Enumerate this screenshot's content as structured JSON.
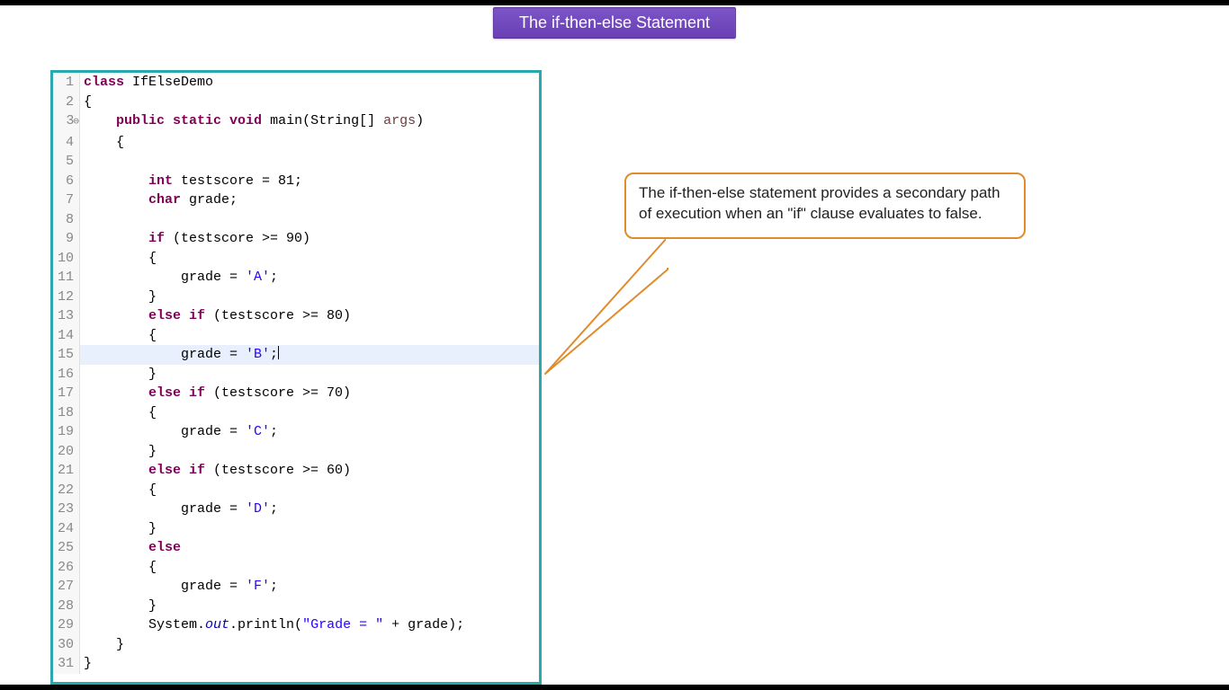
{
  "title": "The if-then-else Statement",
  "callout": "The if-then-else statement provides a secondary path of execution when an \"if\" clause evaluates to false.",
  "code": {
    "highlight_line": 15,
    "lines": [
      {
        "n": "1",
        "html": "<span class='kw'>class</span> <span class='cls'>IfElseDemo</span>",
        "indent": 0
      },
      {
        "n": "2",
        "html": "{",
        "indent": 0
      },
      {
        "n": "3",
        "marker": "⊖",
        "html": "    <span class='kw'>public static void</span> <span class='mth'>main</span>(String[] <span class='par'>args</span>)",
        "indent": 0
      },
      {
        "n": "4",
        "html": "    {",
        "indent": 0
      },
      {
        "n": "5",
        "html": "",
        "indent": 0
      },
      {
        "n": "6",
        "html": "        <span class='kw'>int</span> testscore = 81;",
        "indent": 0
      },
      {
        "n": "7",
        "html": "        <span class='kw'>char</span> grade;",
        "indent": 0
      },
      {
        "n": "8",
        "html": "",
        "indent": 0
      },
      {
        "n": "9",
        "html": "        <span class='kw'>if</span> (testscore &gt;= 90)",
        "indent": 0
      },
      {
        "n": "10",
        "html": "        {",
        "indent": 0
      },
      {
        "n": "11",
        "html": "            grade = <span class='chr'>'A'</span>;",
        "indent": 0
      },
      {
        "n": "12",
        "html": "        }",
        "indent": 0
      },
      {
        "n": "13",
        "html": "        <span class='kw'>else if</span> (testscore &gt;= 80)",
        "indent": 0
      },
      {
        "n": "14",
        "html": "        {",
        "indent": 0
      },
      {
        "n": "15",
        "html": "            grade = <span class='chr'>'B'</span>;<span class='cursor'></span>",
        "indent": 0
      },
      {
        "n": "16",
        "html": "        }",
        "indent": 0
      },
      {
        "n": "17",
        "html": "        <span class='kw'>else if</span> (testscore &gt;= 70)",
        "indent": 0
      },
      {
        "n": "18",
        "html": "        {",
        "indent": 0
      },
      {
        "n": "19",
        "html": "            grade = <span class='chr'>'C'</span>;",
        "indent": 0
      },
      {
        "n": "20",
        "html": "        }",
        "indent": 0
      },
      {
        "n": "21",
        "html": "        <span class='kw'>else if</span> (testscore &gt;= 60)",
        "indent": 0
      },
      {
        "n": "22",
        "html": "        {",
        "indent": 0
      },
      {
        "n": "23",
        "html": "            grade = <span class='chr'>'D'</span>;",
        "indent": 0
      },
      {
        "n": "24",
        "html": "        }",
        "indent": 0
      },
      {
        "n": "25",
        "html": "        <span class='kw'>else</span>",
        "indent": 0
      },
      {
        "n": "26",
        "html": "        {",
        "indent": 0
      },
      {
        "n": "27",
        "html": "            grade = <span class='chr'>'F'</span>;",
        "indent": 0
      },
      {
        "n": "28",
        "html": "        }",
        "indent": 0
      },
      {
        "n": "29",
        "html": "        System.<span class='fld'>out</span>.println(<span class='str'>\"Grade = \"</span> + grade);",
        "indent": 0
      },
      {
        "n": "30",
        "html": "    }",
        "indent": 0
      },
      {
        "n": "31",
        "html": "}",
        "indent": 0
      }
    ]
  }
}
